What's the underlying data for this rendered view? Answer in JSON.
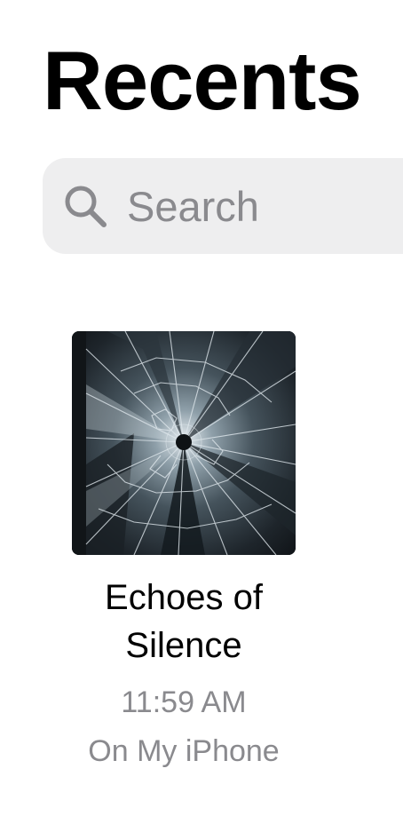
{
  "header": {
    "title": "Recents"
  },
  "search": {
    "placeholder": "Search",
    "icon": "search-icon"
  },
  "files": [
    {
      "name": "Echoes of Silence",
      "time": "11:59 AM",
      "location": "On My iPhone",
      "thumbnail": "shattered-glass-artwork"
    }
  ],
  "colors": {
    "background": "#ffffff",
    "title": "#000000",
    "search_field": "#eeeeef",
    "secondary_text": "#8a8a8e"
  }
}
